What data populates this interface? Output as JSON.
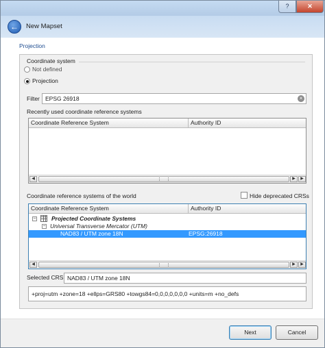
{
  "window": {
    "title": "New Mapset",
    "help_label": "?",
    "close_label": "✕"
  },
  "page": {
    "title": "Projection"
  },
  "coordinate_system": {
    "group_label": "Coordinate system",
    "option_not_defined": "Not defined",
    "option_projection": "Projection",
    "selected": "Projection"
  },
  "filter": {
    "label": "Filter",
    "value": "EPSG 26918"
  },
  "recent_crs": {
    "label": "Recently used coordinate reference systems",
    "columns": [
      "Coordinate Reference System",
      "Authority ID"
    ],
    "rows": []
  },
  "world_crs": {
    "label": "Coordinate reference systems of the world",
    "hide_deprecated_label": "Hide deprecated CRSs",
    "hide_deprecated_checked": false,
    "columns": [
      "Coordinate Reference System",
      "Authority ID"
    ],
    "tree": {
      "group": "Projected Coordinate Systems",
      "subgroup": "Universal Transverse Mercator (UTM)",
      "selected_item": {
        "name": "NAD83 / UTM zone 18N",
        "authority_id": "EPSG:26918"
      }
    }
  },
  "selected_crs": {
    "label": "Selected CRS:",
    "value": "NAD83 / UTM zone 18N",
    "proj_string": "+proj=utm +zone=18 +ellps=GRS80 +towgs84=0,0,0,0,0,0,0 +units=m +no_defs"
  },
  "buttons": {
    "next": "Next",
    "cancel": "Cancel"
  },
  "icons": {
    "back": "back-arrow-icon",
    "clear": "clear-icon",
    "grid": "grid-icon"
  }
}
